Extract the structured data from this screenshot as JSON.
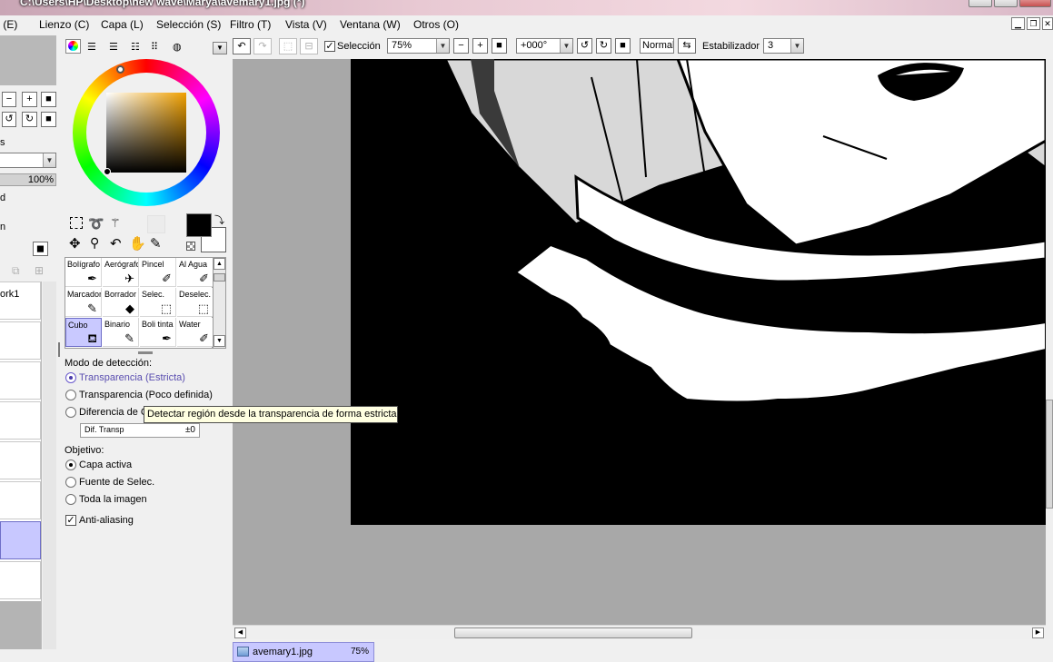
{
  "window": {
    "title": "C:\\Users\\HP\\Desktop\\new wave\\Marya\\avemary1.jpg (*)"
  },
  "menu": {
    "items": [
      {
        "label": "r (E)"
      },
      {
        "label": "Lienzo (C)"
      },
      {
        "label": "Capa (L)"
      },
      {
        "label": "Selección (S)"
      },
      {
        "label": "Filtro (T)"
      },
      {
        "label": "Vista (V)"
      },
      {
        "label": "Ventana (W)"
      },
      {
        "label": "Otros (O)"
      }
    ]
  },
  "toolbar": {
    "selection_label": "Selección",
    "selection_checked": true,
    "zoom_value": "75%",
    "rotation_value": "+000°",
    "blend_mode": "Normal",
    "stabilizer_label": "Estabilizador",
    "stabilizer_value": "3"
  },
  "left_panel": {
    "partial_label_s": "s",
    "opacity_value": "100%",
    "partial_label_d": "d",
    "partial_label_n": "n",
    "layer_name": "ork1"
  },
  "tools": {
    "grid": [
      {
        "label": "Bolígrafo",
        "icon": "pen-icon"
      },
      {
        "label": "Aerógrafo",
        "icon": "airbrush-icon"
      },
      {
        "label": "Pincel",
        "icon": "brush-icon"
      },
      {
        "label": "Al Agua",
        "icon": "watercolor-icon"
      },
      {
        "label": "Marcador",
        "icon": "marker-icon"
      },
      {
        "label": "Borrador",
        "icon": "eraser-icon"
      },
      {
        "label": "Selec.",
        "icon": "select-brush-icon"
      },
      {
        "label": "Deselec.",
        "icon": "deselect-brush-icon"
      },
      {
        "label": "Cubo",
        "icon": "bucket-icon"
      },
      {
        "label": "Binario",
        "icon": "binary-pen-icon"
      },
      {
        "label": "Boli tinta",
        "icon": "ink-pen-icon"
      },
      {
        "label": "Water",
        "icon": "water-icon"
      }
    ],
    "selected": "Cubo"
  },
  "options": {
    "detection_label": "Modo de detección:",
    "detection_options": [
      "Transparencia (Estricta)",
      "Transparencia (Poco definida)",
      "Diferencia de C"
    ],
    "detection_selected": 0,
    "dif_label": "Dif. Transp",
    "dif_value": "±0",
    "target_label": "Objetivo:",
    "target_options": [
      "Capa activa",
      "Fuente de Selec.",
      "Toda la imagen"
    ],
    "target_selected": 0,
    "antialias_label": "Anti-aliasing",
    "antialias_checked": true
  },
  "tooltip": {
    "text": "Detectar región desde la transparencia de forma estricta"
  },
  "document_tab": {
    "name": "avemary1.jpg",
    "zoom": "75%"
  },
  "colors": {
    "current_primary": "#000000",
    "current_secondary": "#ffffff",
    "selection_highlight": "#c8c8ff"
  }
}
